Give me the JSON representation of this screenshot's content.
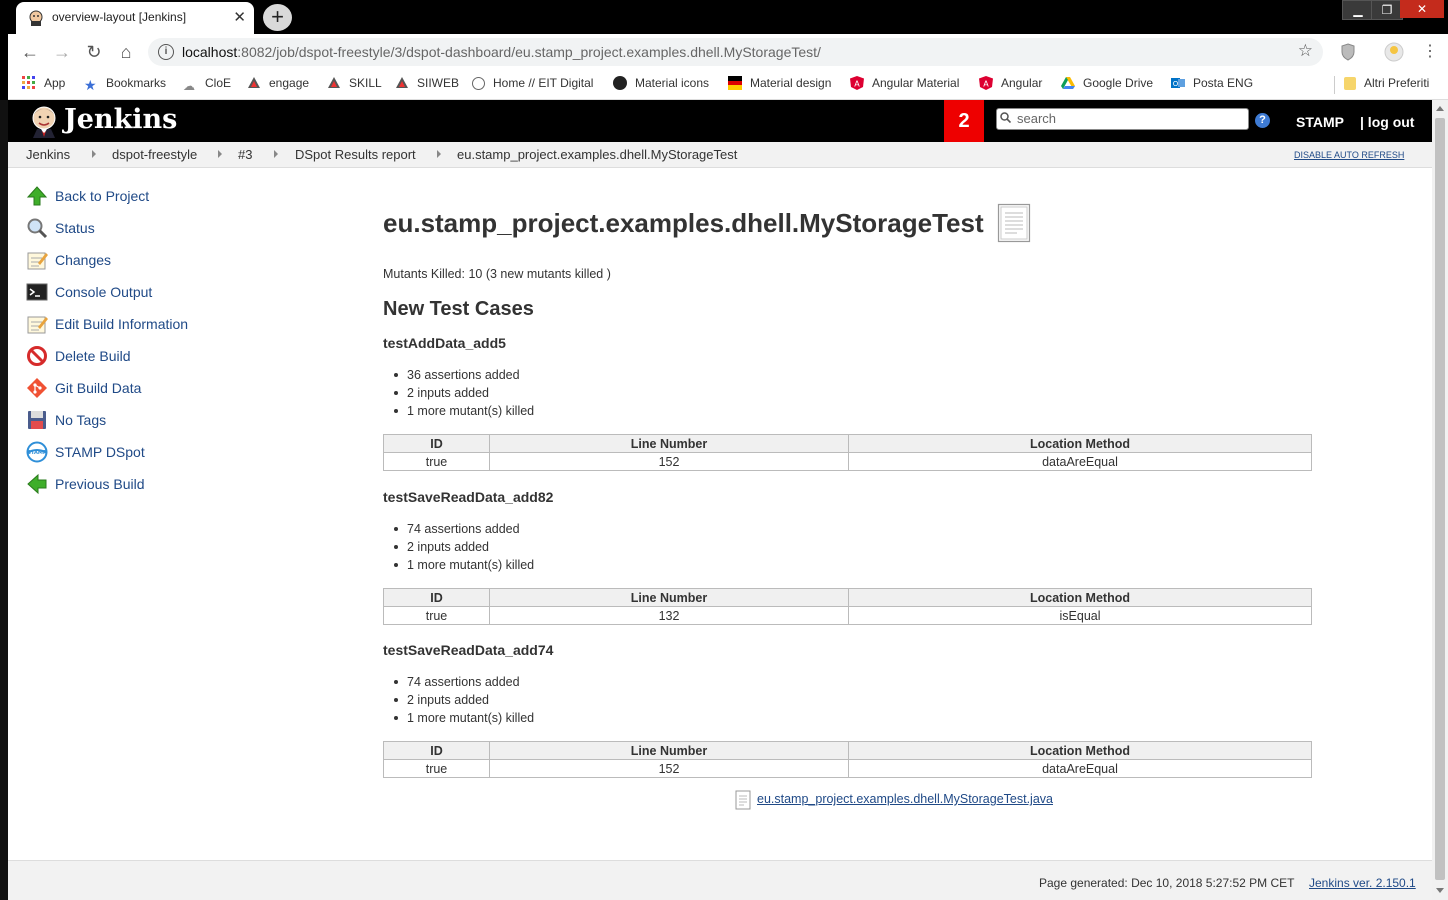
{
  "browser": {
    "tab_title": "overview-layout [Jenkins]",
    "new_tab_label": "+",
    "url_host": "localhost",
    "url_rest": ":8082/job/dspot-freestyle/3/dspot-dashboard/eu.stamp_project.examples.dhell.MyStorageTest/",
    "bookmarks": [
      "App",
      "Bookmarks",
      "CloE",
      "engage",
      "SKILL",
      "SIIWEB",
      "Home // EIT Digital",
      "Material icons",
      "Material design",
      "Angular Material",
      "Angular",
      "Google Drive",
      "Posta ENG",
      "Altri Preferiti"
    ]
  },
  "header": {
    "logo_text": "Jenkins",
    "notification_count": "2",
    "search_placeholder": "search",
    "help_label": "?",
    "user_name": "STAMP",
    "logout_label": "| log out"
  },
  "breadcrumb": {
    "items": [
      "Jenkins",
      "dspot-freestyle",
      "#3",
      "DSpot Results report",
      "eu.stamp_project.examples.dhell.MyStorageTest"
    ],
    "auto_refresh": "DISABLE AUTO REFRESH"
  },
  "sidebar": {
    "items": [
      {
        "label": "Back to Project",
        "icon": "up-arrow-icon"
      },
      {
        "label": "Status",
        "icon": "magnifier-icon"
      },
      {
        "label": "Changes",
        "icon": "notepad-icon"
      },
      {
        "label": "Console Output",
        "icon": "terminal-icon"
      },
      {
        "label": "Edit Build Information",
        "icon": "notepad-edit-icon"
      },
      {
        "label": "Delete Build",
        "icon": "no-entry-icon"
      },
      {
        "label": "Git Build Data",
        "icon": "git-icon"
      },
      {
        "label": "No Tags",
        "icon": "floppy-icon"
      },
      {
        "label": "STAMP DSpot",
        "icon": "stamp-icon"
      },
      {
        "label": "Previous Build",
        "icon": "left-arrow-icon"
      }
    ]
  },
  "main": {
    "title": "eu.stamp_project.examples.dhell.MyStorageTest",
    "mutants_killed": "Mutants Killed: 10 (3 new mutants killed )",
    "section_title": "New Test Cases",
    "table_headers": [
      "ID",
      "Line Number",
      "Location Method"
    ],
    "tests": [
      {
        "name": "testAddData_add5",
        "bullets": [
          "36 assertions added",
          "2 inputs added",
          "1 more mutant(s) killed"
        ],
        "row": [
          "true",
          "152",
          "dataAreEqual"
        ]
      },
      {
        "name": "testSaveReadData_add82",
        "bullets": [
          "74 assertions added",
          "2 inputs added",
          "1 more mutant(s) killed"
        ],
        "row": [
          "true",
          "132",
          "isEqual"
        ]
      },
      {
        "name": "testSaveReadData_add74",
        "bullets": [
          "74 assertions added",
          "2 inputs added",
          "1 more mutant(s) killed"
        ],
        "row": [
          "true",
          "152",
          "dataAreEqual"
        ]
      }
    ],
    "file_link": " eu.stamp_project.examples.dhell.MyStorageTest.java"
  },
  "footer": {
    "generated": "Page generated: Dec 10, 2018 5:27:52 PM CET",
    "version": "Jenkins ver. 2.150.1"
  },
  "colors": {
    "link": "#204a87",
    "header_bg": "#000000",
    "badge_red": "#ee0000"
  }
}
